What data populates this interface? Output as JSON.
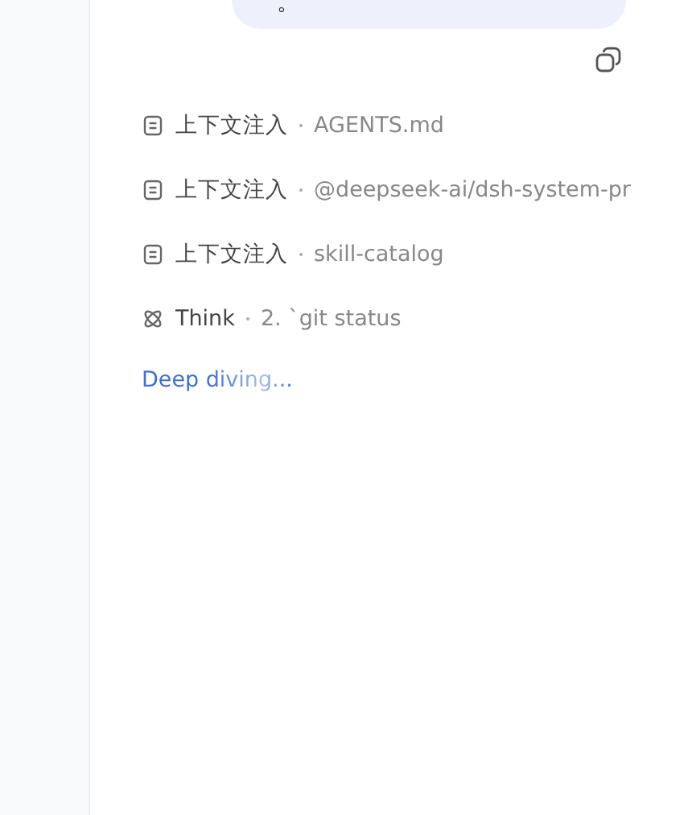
{
  "message": {
    "text": "。"
  },
  "steps": [
    {
      "kind": "context",
      "label": "上下文注入",
      "detail": "AGENTS.md"
    },
    {
      "kind": "context",
      "label": "上下文注入",
      "detail": "@deepseek-ai/dsh-system-pr"
    },
    {
      "kind": "context",
      "label": "上下文注入",
      "detail": "skill-catalog"
    },
    {
      "kind": "think",
      "label": "Think",
      "detail": "2. `git status"
    }
  ],
  "status": "Deep diving..."
}
